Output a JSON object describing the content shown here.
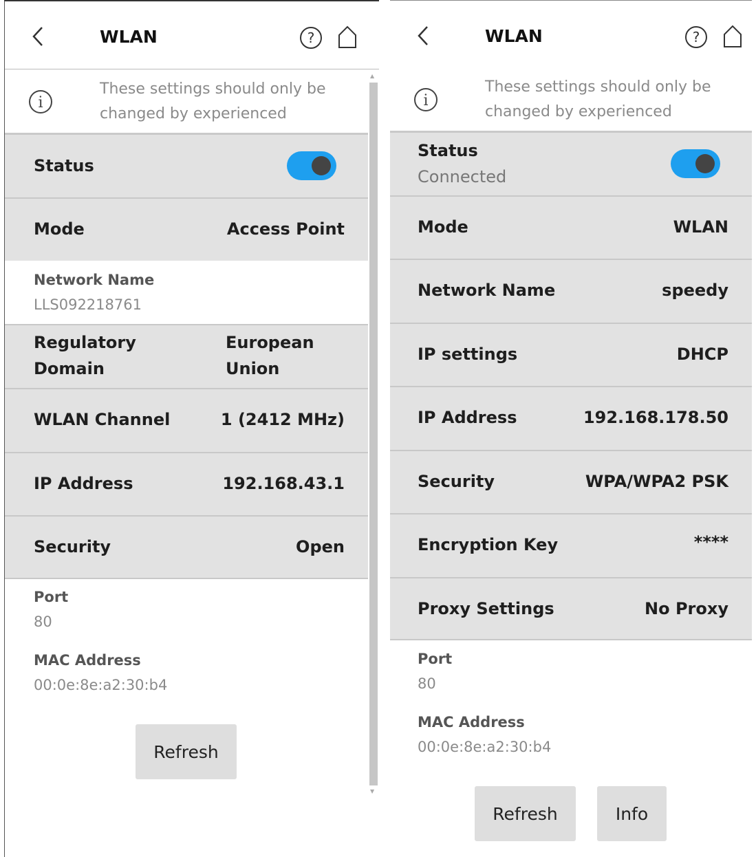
{
  "left": {
    "title": "WLAN",
    "info": "These settings should only be changed by experienced users.",
    "status_label": "Status",
    "mode": {
      "label": "Mode",
      "value": "Access Point"
    },
    "network_name": {
      "label": "Network Name",
      "value": "LLS092218761"
    },
    "regulatory_domain": {
      "label_line1": "Regulatory",
      "label_line2": "Domain",
      "value_line1": "European",
      "value_line2": "Union"
    },
    "wlan_channel": {
      "label": "WLAN Channel",
      "value": "1 (2412 MHz)"
    },
    "ip_address": {
      "label": "IP Address",
      "value": "192.168.43.1"
    },
    "security": {
      "label": "Security",
      "value": "Open"
    },
    "port": {
      "label": "Port",
      "value": "80"
    },
    "mac": {
      "label": "MAC Address",
      "value": "00:0e:8e:a2:30:b4"
    },
    "refresh_label": "Refresh"
  },
  "right": {
    "title": "WLAN",
    "info": "These settings should only be changed by experienced users.",
    "status": {
      "label": "Status",
      "value": "Connected"
    },
    "mode": {
      "label": "Mode",
      "value": "WLAN"
    },
    "network_name": {
      "label": "Network Name",
      "value": "speedy"
    },
    "ip_settings": {
      "label": "IP settings",
      "value": "DHCP"
    },
    "ip_address": {
      "label": "IP Address",
      "value": "192.168.178.50"
    },
    "security": {
      "label": "Security",
      "value": "WPA/WPA2 PSK"
    },
    "encryption_key": {
      "label": "Encryption Key",
      "value": "****"
    },
    "proxy": {
      "label": "Proxy Settings",
      "value": "No Proxy"
    },
    "port": {
      "label": "Port",
      "value": "80"
    },
    "mac": {
      "label": "MAC Address",
      "value": "00:0e:8e:a2:30:b4"
    },
    "refresh_label": "Refresh",
    "info_label": "Info"
  },
  "icons": {
    "back": "chevron-left-icon",
    "help": "question-circle-icon",
    "home": "home-icon",
    "info": "info-circle-icon"
  },
  "colors": {
    "toggle_on": "#1e9fef",
    "row_gray": "#e2e2e2",
    "button": "#dedede"
  },
  "status_toggle_on": true
}
